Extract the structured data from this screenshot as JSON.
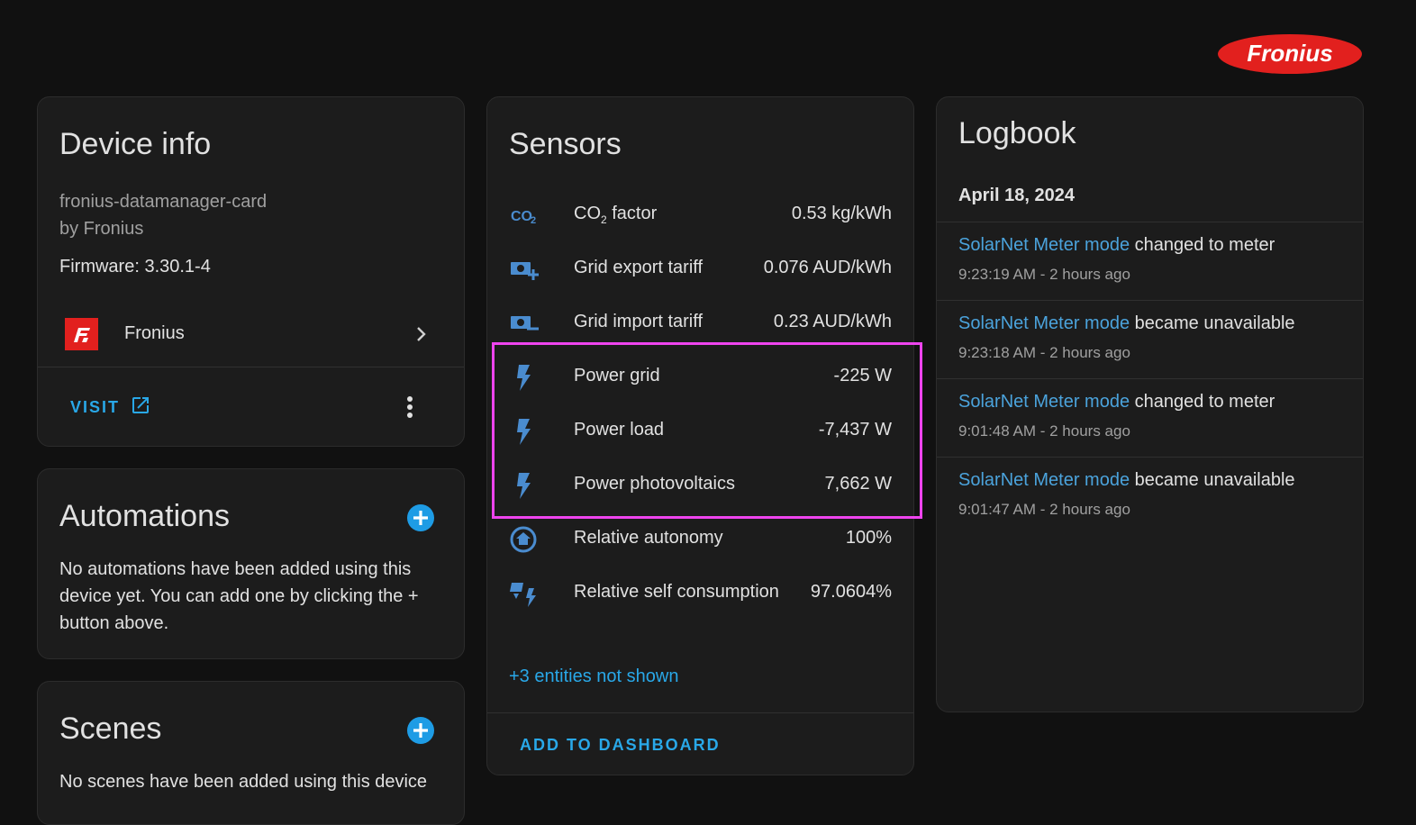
{
  "brand": {
    "logo_text": "Fronius",
    "accent": "#e2201e"
  },
  "device_info": {
    "title": "Device info",
    "model": "fronius-datamanager-card",
    "manufacturer": "by Fronius",
    "firmware": "Firmware: 3.30.1-4",
    "integration_name": "Fronius",
    "visit_label": "VISIT"
  },
  "automations": {
    "title": "Automations",
    "empty_text": "No automations have been added using this device yet. You can add one by clicking the + button above."
  },
  "scenes": {
    "title": "Scenes",
    "empty_text": "No scenes have been added using this device"
  },
  "sensors": {
    "title": "Sensors",
    "rows": [
      {
        "icon": "co2-icon",
        "name_main": "CO",
        "name_sub": "2",
        "name_rest": " factor",
        "value": "0.53 kg/kWh"
      },
      {
        "icon": "cash-plus-icon",
        "name": "Grid export tariff",
        "value": "0.076 AUD/kWh"
      },
      {
        "icon": "cash-minus-icon",
        "name": "Grid import tariff",
        "value": "0.23 AUD/kWh"
      },
      {
        "icon": "flash-icon",
        "name": "Power grid",
        "value": "-225 W"
      },
      {
        "icon": "flash-icon",
        "name": "Power load",
        "value": "-7,437 W"
      },
      {
        "icon": "flash-icon",
        "name": "Power photovoltaics",
        "value": "7,662 W"
      },
      {
        "icon": "home-circle-icon",
        "name": "Relative autonomy",
        "value": "100%"
      },
      {
        "icon": "solar-power-icon",
        "name": "Relative self consumption",
        "value": "97.0604%"
      }
    ],
    "more_label": "+3 entities not shown",
    "add_label": "ADD TO DASHBOARD"
  },
  "logbook": {
    "title": "Logbook",
    "date": "April 18, 2024",
    "entries": [
      {
        "entity": "SolarNet Meter mode",
        "message": " changed to meter",
        "time": "9:23:19 AM - 2 hours ago"
      },
      {
        "entity": "SolarNet Meter mode",
        "message": " became unavailable",
        "time": "9:23:18 AM - 2 hours ago"
      },
      {
        "entity": "SolarNet Meter mode",
        "message": " changed to meter",
        "time": "9:01:48 AM - 2 hours ago"
      },
      {
        "entity": "SolarNet Meter mode",
        "message": " became unavailable",
        "time": "9:01:47 AM - 2 hours ago"
      }
    ]
  },
  "colors": {
    "link": "#29a8e8",
    "highlight": "#ee44ee",
    "entity_link": "#4ba3dc"
  }
}
